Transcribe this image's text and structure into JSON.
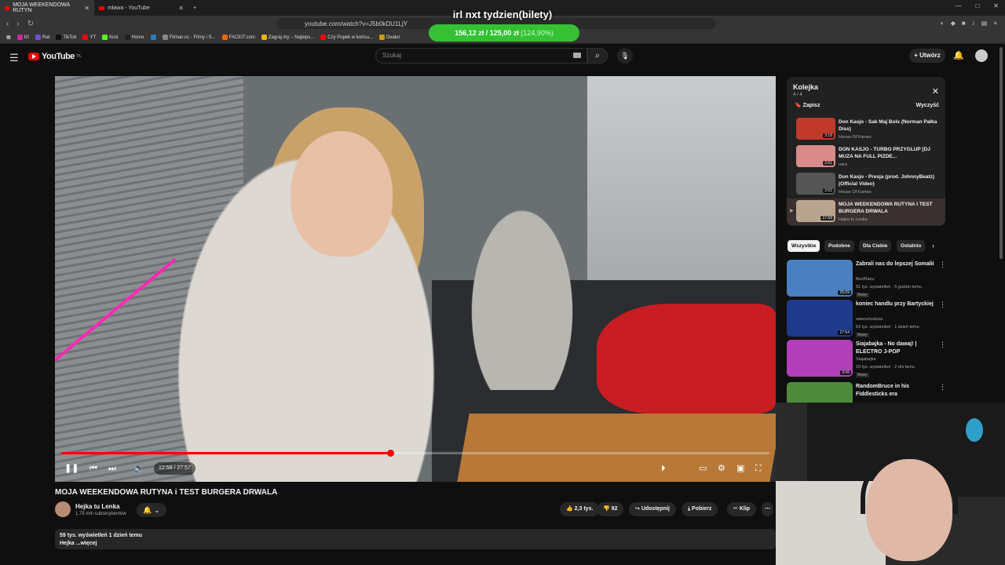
{
  "browser": {
    "tabs": [
      {
        "label": "MOJA WEEKENDOWA RUTYN"
      },
      {
        "label": "mława - YouTube"
      }
    ],
    "url": "youtube.com/watch?v=J5b0kDU1LjY",
    "bookmarks": [
      "IG",
      "Rat",
      "TikTok",
      "YT",
      "Kick",
      "Home",
      "Filman.cc - Filmy i S...",
      "FACEIT.com",
      "Zagraj.my – Najleps...",
      "Czy Popek w końcu...",
      "Dealer"
    ]
  },
  "overlay": {
    "title": "irl nxt tydzien(bilety)",
    "amount": "156,12 zł",
    "separator": "/",
    "goal": "125,00 zł",
    "percent": "(124,90%)"
  },
  "youtube": {
    "logo": "YouTube",
    "region": "PL",
    "search_placeholder": "Szukaj",
    "create_label": "Utwórz"
  },
  "player": {
    "time": "12:58 / 27:57",
    "progress_fraction": 0.464
  },
  "video": {
    "title": "MOJA WEEKENDOWA RUTYNA i TEST BURGERA DRWALA",
    "channel": "Hejka tu Lenka",
    "subscribers": "1,75 mln subskrybentów",
    "likes": "2,3 tys.",
    "dislikes": "92",
    "share": "Udostępnij",
    "download": "Pobierz",
    "clip": "Klip",
    "views_date": "59 tys. wyświetleń  1 dzień temu",
    "description": "Hejka ...więcej"
  },
  "queue": {
    "title": "Kolejka",
    "count": "4 / 4",
    "save": "Zapisz",
    "clear": "Wyczyść",
    "items": [
      {
        "title": "Don Kasjo - Sak Maj Bols (Norman Pałka Diss)",
        "channel": "House Of Fames",
        "duration": "3:18",
        "color": "#c0392b"
      },
      {
        "title": "DON KASJO - TURBO PRZYGLUP [DJ MUZA NA FULL PIZDE...",
        "channel": "nara",
        "duration": "2:01",
        "color": "#d98a8a"
      },
      {
        "title": "Don Kasjo - Presja (prod. JohnnyBeatz) (Official Video)",
        "channel": "House Of Fames",
        "duration": "3:52",
        "color": "#555555"
      },
      {
        "title": "MOJA WEEKENDOWA RUTYNA I TEST BURGERA DRWALA",
        "channel": "Hejka tu Lenka",
        "duration": "27:58",
        "color": "#b9a58e"
      }
    ]
  },
  "chips": [
    "Wszystkie",
    "Podobne",
    "Dla Ciebie",
    "Ostatnio"
  ],
  "recommended": [
    {
      "title": "Zabrali nas do lepszej Somalii",
      "channel": "BezPlanu",
      "meta": "51 tys. wyświetleń · 5 godzin temu",
      "badge": "Nowy",
      "duration": "25:09",
      "color": "#4a7fc1"
    },
    {
      "title": "koniec handlu przy Bartyckiej",
      "channel": "samochodoza",
      "meta": "63 tys. wyświetleń · 1 dzień temu",
      "badge": "Nowy",
      "duration": "27:54",
      "color": "#1f3a8a"
    },
    {
      "title": "Siajabajka - No dawaj! | ELECTRO J-POP",
      "channel": "Siajabajka",
      "meta": "10 tys. wyświetleń · 2 dni temu",
      "badge": "Nowy",
      "duration": "3:06",
      "color": "#b23fb8"
    },
    {
      "title": "RandomBruce in his Fiddlesticks era",
      "channel": "",
      "meta": "",
      "badge": "",
      "duration": "",
      "color": "#4f8a3c"
    }
  ]
}
